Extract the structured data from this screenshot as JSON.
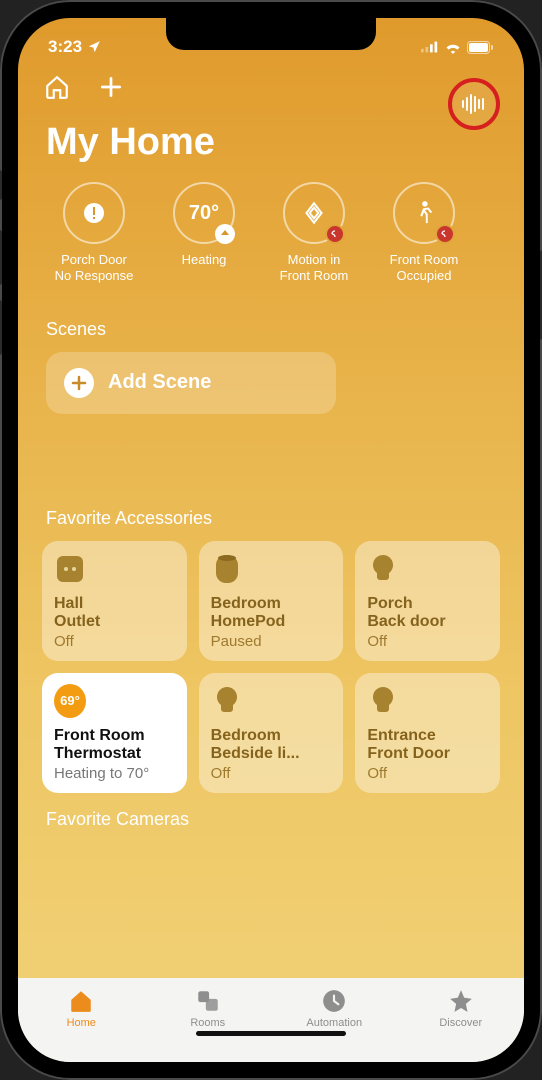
{
  "status_bar": {
    "time": "3:23"
  },
  "title": "My Home",
  "status_chips": [
    {
      "icon": "alert",
      "line1": "Porch Door",
      "line2": "No Response"
    },
    {
      "value": "70°",
      "line1": "Heating",
      "line2": ""
    },
    {
      "icon": "motion",
      "line1": "Motion in",
      "line2": "Front Room"
    },
    {
      "icon": "walk",
      "line1": "Front Room",
      "line2": "Occupied"
    }
  ],
  "scenes": {
    "section": "Scenes",
    "add_label": "Add Scene"
  },
  "favorites": {
    "section": "Favorite Accessories",
    "tiles": [
      {
        "name1": "Hall",
        "name2": "Outlet",
        "state": "Off",
        "icon": "outlet"
      },
      {
        "name1": "Bedroom",
        "name2": "HomePod",
        "state": "Paused",
        "icon": "homepod"
      },
      {
        "name1": "Porch",
        "name2": "Back door",
        "state": "Off",
        "icon": "bulb"
      },
      {
        "name1": "Front Room",
        "name2": "Thermostat",
        "state": "Heating to 70°",
        "icon": "thermo",
        "badge": "69°",
        "active": true
      },
      {
        "name1": "Bedroom",
        "name2": "Bedside li...",
        "state": "Off",
        "icon": "bulb"
      },
      {
        "name1": "Entrance",
        "name2": "Front Door",
        "state": "Off",
        "icon": "bulb"
      }
    ]
  },
  "cameras_section": "Favorite Cameras",
  "tabs": [
    {
      "label": "Home",
      "icon": "home",
      "active": true
    },
    {
      "label": "Rooms",
      "icon": "rooms"
    },
    {
      "label": "Automation",
      "icon": "clock"
    },
    {
      "label": "Discover",
      "icon": "star"
    }
  ]
}
